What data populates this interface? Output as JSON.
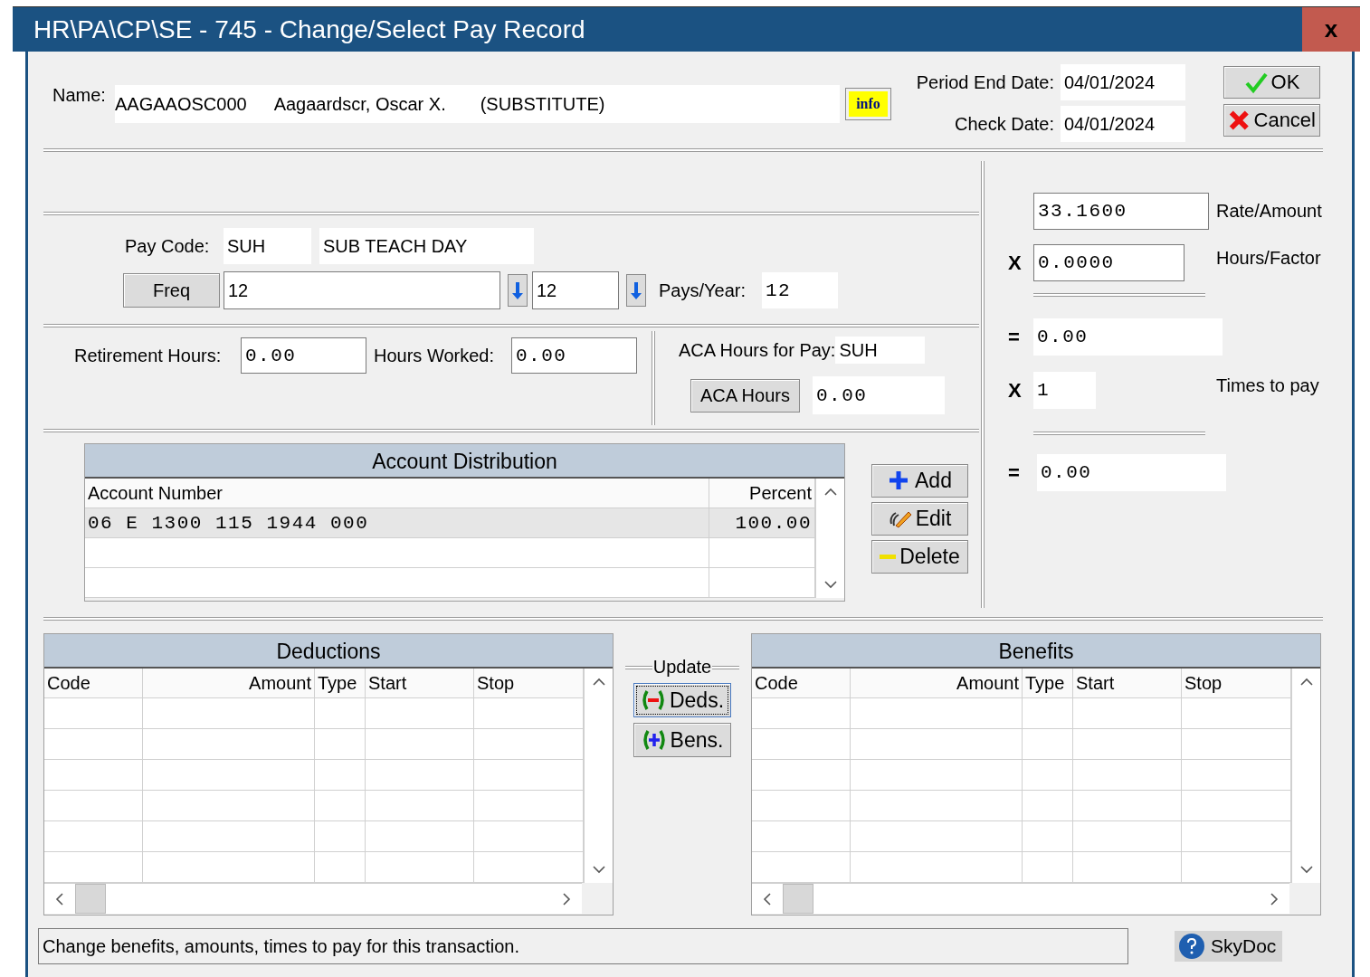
{
  "window": {
    "title": "HR\\PA\\CP\\SE - 745 - Change/Select Pay Record",
    "close_label": "x"
  },
  "header": {
    "name_label": "Name:",
    "name_parts": [
      "AAGAAOSC000",
      "Aagaardscr, Oscar X.",
      "(SUBSTITUTE)"
    ],
    "info_label": "info",
    "dates": [
      {
        "label": "Period End Date:",
        "value": "04/01/2024"
      },
      {
        "label": "Check Date:",
        "value": "04/01/2024"
      }
    ],
    "buttons": [
      {
        "label": "OK"
      },
      {
        "label": "Cancel"
      }
    ]
  },
  "pay_code": {
    "label": "Pay Code:",
    "code": "SUH",
    "description": "SUB TEACH DAY"
  },
  "frequency": {
    "button": "Freq",
    "value": "12",
    "value_2": "12",
    "pays_label": "Pays/Year:",
    "pays_value": "12"
  },
  "hours": {
    "retirement_label": "Retirement Hours:",
    "retirement_value": "0.00",
    "worked_label": "Hours Worked:",
    "worked_value": "0.00",
    "aca_pay_label": "ACA Hours for Pay:",
    "aca_pay_value": "SUH",
    "aca_button": "ACA Hours",
    "aca_value": "0.00"
  },
  "account_distribution": {
    "title": "Account Distribution",
    "columns": [
      "Account Number",
      "Percent"
    ],
    "rows": [
      {
        "cells": [
          "06 E 1300 115 1944 000",
          "100.00"
        ],
        "selected": true
      }
    ],
    "buttons": [
      {
        "label": "Add"
      },
      {
        "label": "Edit"
      },
      {
        "label": "Delete"
      }
    ]
  },
  "calculation": [
    {
      "kind": "field",
      "value": "33.1600",
      "label": "Rate/Amount",
      "editable": true
    },
    {
      "kind": "field",
      "operator": "X",
      "value": "0.0000",
      "label": "Hours/Factor",
      "editable": true
    },
    {
      "kind": "rule"
    },
    {
      "kind": "field",
      "operator": "=",
      "value": "0.00",
      "editable": false
    },
    {
      "kind": "field",
      "operator": "X",
      "value": "1",
      "label": "Times to pay",
      "editable": false
    },
    {
      "kind": "rule"
    },
    {
      "kind": "field",
      "operator": "=",
      "value": "0.00",
      "editable": false
    }
  ],
  "deductions": {
    "title": "Deductions",
    "columns": [
      "Code",
      "Amount",
      "Type",
      "Start",
      "Stop"
    ]
  },
  "update": {
    "label": "Update",
    "buttons": [
      {
        "label": "Deds.",
        "focused": true
      },
      {
        "label": "Bens.",
        "focused": false
      }
    ]
  },
  "benefits": {
    "title": "Benefits",
    "columns": [
      "Code",
      "Amount",
      "Type",
      "Start",
      "Stop"
    ]
  },
  "status_bar": {
    "text": "Change benefits, amounts, times to pay for this transaction.",
    "help_button": "SkyDoc"
  }
}
